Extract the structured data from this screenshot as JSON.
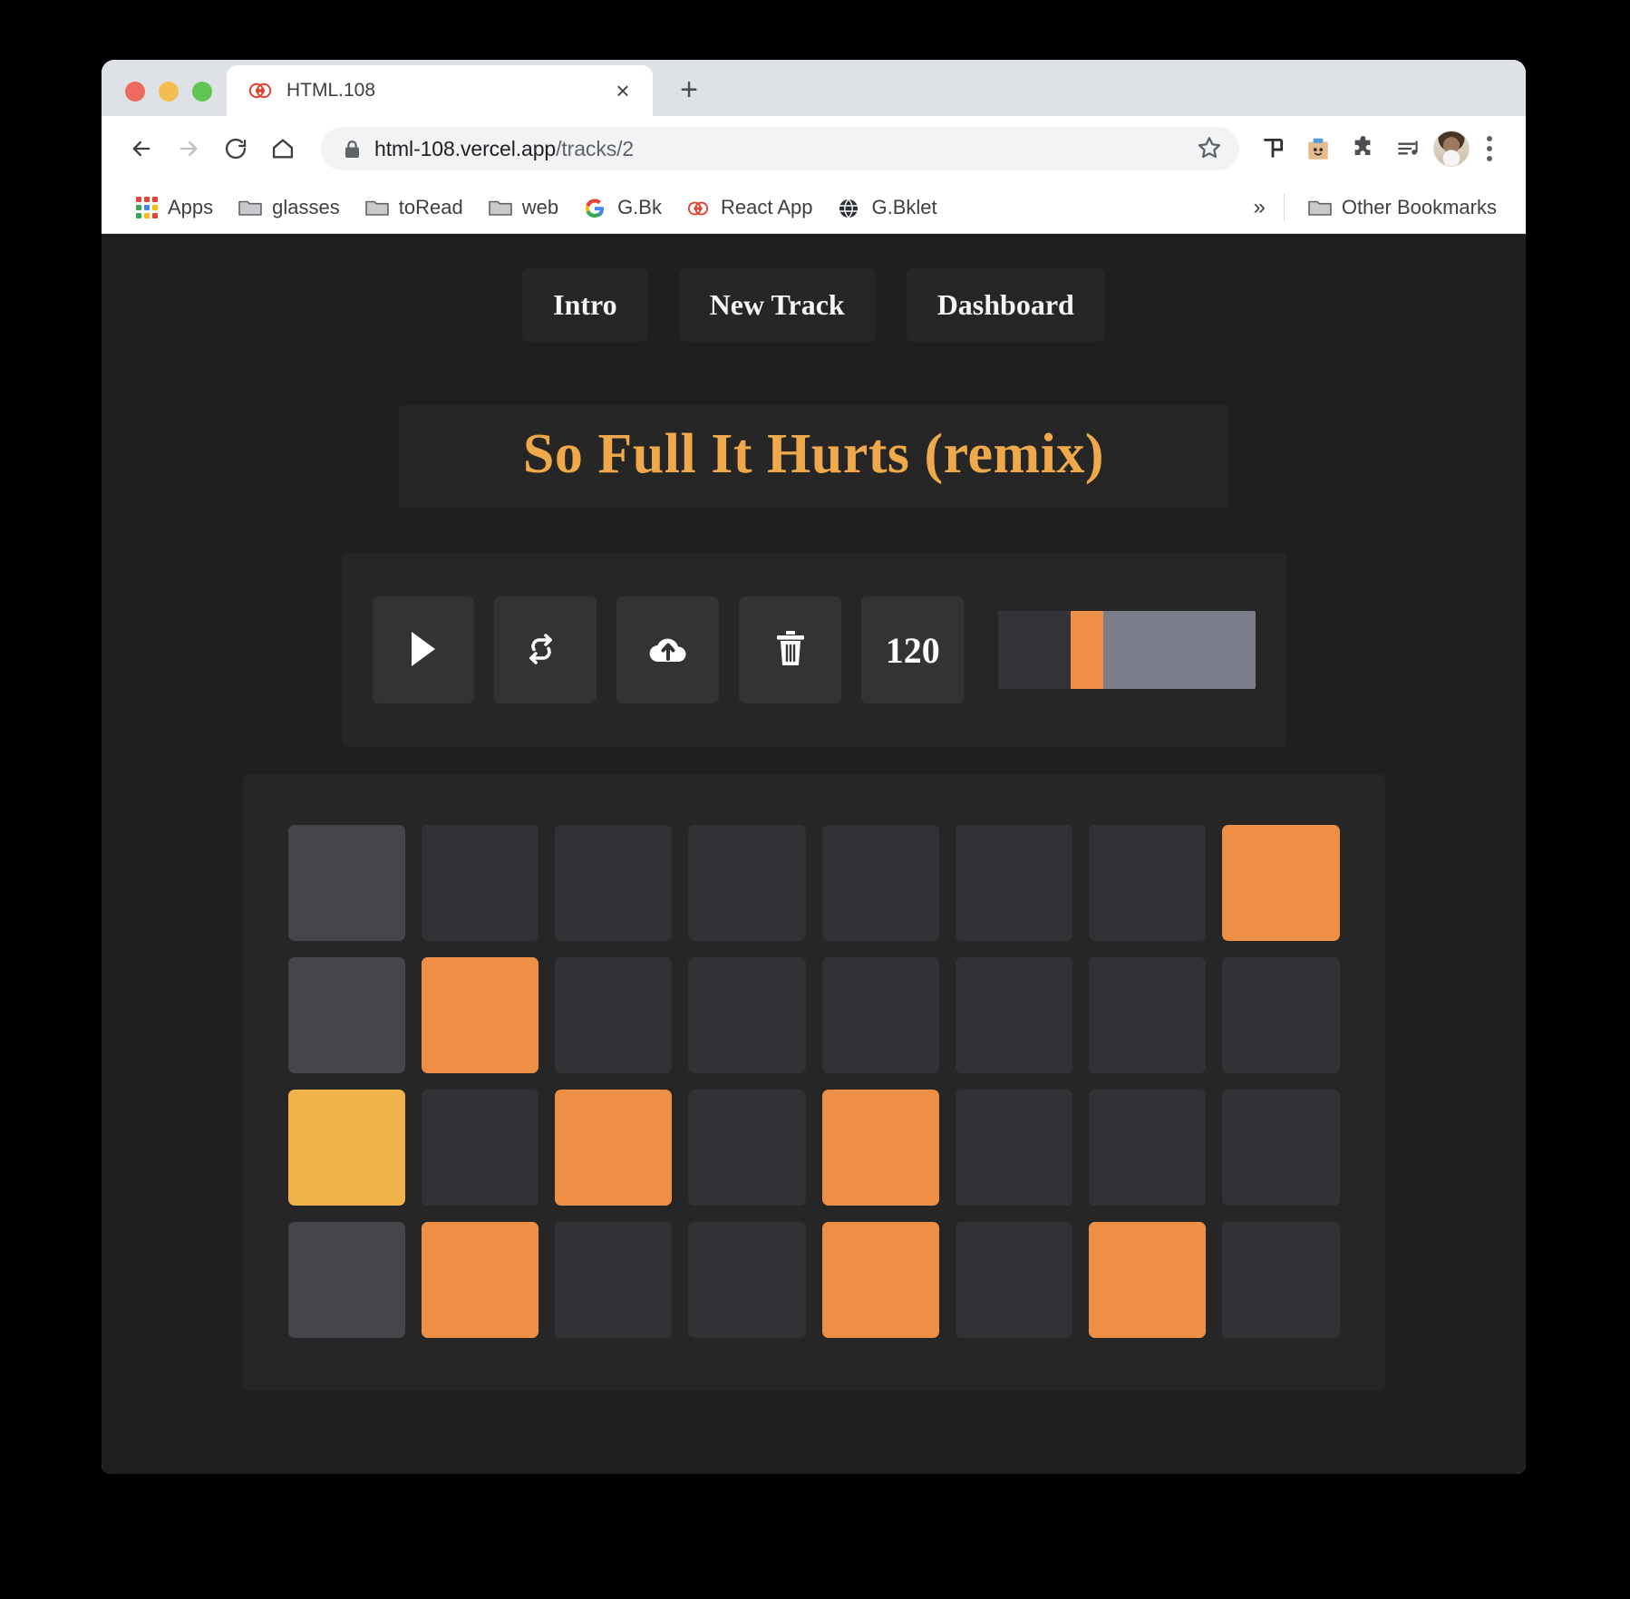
{
  "browser": {
    "tab": {
      "title": "HTML.108",
      "favicon": "react-app-icon",
      "close_label": "×"
    },
    "new_tab_label": "+",
    "nav": {
      "back_label": "back-arrow",
      "forward_label": "forward-arrow",
      "reload_label": "reload",
      "home_label": "home"
    },
    "omnibox": {
      "lock": "lock-icon",
      "url_host": "html-108.vercel.app",
      "url_path": "/tracks/2",
      "star": "bookmark-star-icon"
    },
    "extensions": [
      {
        "name": "tabs-outliner-icon"
      },
      {
        "name": "clipboard-box-icon"
      },
      {
        "name": "puzzle-extensions-icon"
      },
      {
        "name": "music-playlist-icon"
      }
    ],
    "profile": "user-avatar",
    "menu": "three-dot-menu",
    "bookmarks": [
      {
        "label": "Apps",
        "icon": "apps-grid-icon"
      },
      {
        "label": "glasses",
        "icon": "folder-icon"
      },
      {
        "label": "toRead",
        "icon": "folder-icon"
      },
      {
        "label": "web",
        "icon": "folder-icon"
      },
      {
        "label": "G.Bk",
        "icon": "google-icon"
      },
      {
        "label": "React App",
        "icon": "react-app-icon"
      },
      {
        "label": "G.Bklet",
        "icon": "globe-icon"
      }
    ],
    "bookmarks_overflow": "»",
    "other_bookmarks": {
      "label": "Other Bookmarks",
      "icon": "folder-icon"
    }
  },
  "app": {
    "nav_buttons": [
      {
        "label": "Intro"
      },
      {
        "label": "New Track"
      },
      {
        "label": "Dashboard"
      }
    ],
    "track_title": "So Full It Hurts (remix)",
    "controls": {
      "play_label": "play-icon",
      "loop_label": "recycle-loop-icon",
      "upload_label": "cloud-upload-icon",
      "delete_label": "trash-icon",
      "bpm_value": "120",
      "volume_slider": {
        "name": "volume-slider",
        "left_pct": 28,
        "thumb_pct": 13,
        "right_pct": 59
      }
    },
    "colors": {
      "accent_orange": "#ef8f46",
      "accent_yellow": "#f2b24b",
      "title_orange": "#efa94a",
      "cell_off": "#323236",
      "cell_off_light": "#45464c",
      "panel": "#262626",
      "page_bg": "#1f1f1f"
    },
    "sequencer": {
      "rows": 4,
      "cols": 8,
      "states": [
        [
          "off-light",
          "off",
          "off",
          "off",
          "off",
          "off",
          "off",
          "on"
        ],
        [
          "off-light",
          "on",
          "off",
          "off",
          "off",
          "off",
          "off",
          "off"
        ],
        [
          "accent",
          "off",
          "on",
          "off",
          "on",
          "off",
          "off",
          "off"
        ],
        [
          "off-light",
          "on",
          "off",
          "off",
          "on",
          "off",
          "on",
          "off"
        ]
      ]
    }
  }
}
